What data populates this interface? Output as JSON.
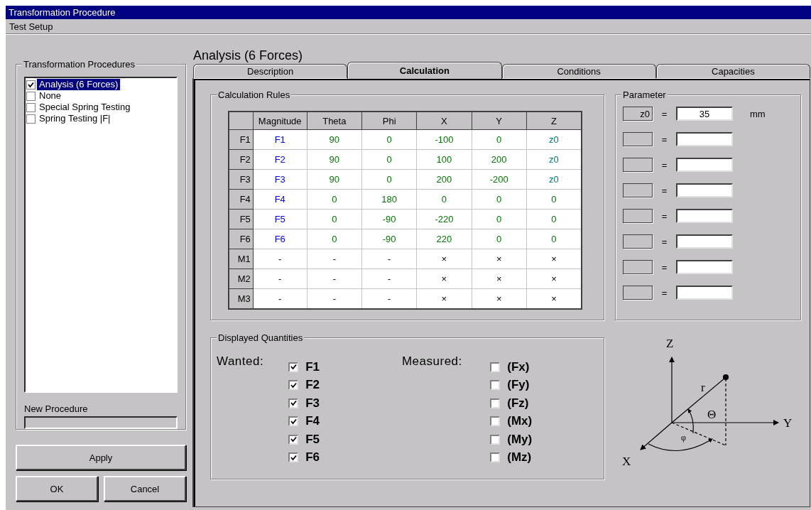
{
  "window": {
    "title": "Transformation Procedure"
  },
  "menu": [
    "Test Setup"
  ],
  "procedures": {
    "title": "Transformation Procedures",
    "items": [
      {
        "label": "Analysis (6 Forces)",
        "checked": true,
        "selected": true
      },
      {
        "label": "None",
        "checked": false,
        "selected": false
      },
      {
        "label": "Special Spring Testing",
        "checked": false,
        "selected": false
      },
      {
        "label": "Spring Testing |F|",
        "checked": false,
        "selected": false
      }
    ],
    "new_procedure": {
      "label": "New Procedure"
    }
  },
  "buttons": {
    "apply": "Apply",
    "ok": "OK",
    "cancel": "Cancel"
  },
  "heading": "Analysis (6 Forces)",
  "tabs": [
    {
      "label": "Description",
      "selected": false
    },
    {
      "label": "Calculation",
      "selected": true
    },
    {
      "label": "Conditions",
      "selected": false
    },
    {
      "label": "Capacities",
      "selected": false
    }
  ],
  "calculation_rules": {
    "title": "Calculation Rules",
    "columns": [
      "Magnitude",
      "Theta",
      "Phi",
      "X",
      "Y",
      "Z"
    ],
    "rows": [
      {
        "header": "F1",
        "cells": [
          {
            "text": "F1",
            "kind": "force"
          },
          {
            "text": "90",
            "kind": "value"
          },
          {
            "text": "0",
            "kind": "value"
          },
          {
            "text": "-100",
            "kind": "value"
          },
          {
            "text": "0",
            "kind": "value"
          },
          {
            "text": "z0",
            "kind": "param"
          }
        ]
      },
      {
        "header": "F2",
        "cells": [
          {
            "text": "F2",
            "kind": "force"
          },
          {
            "text": "90",
            "kind": "value"
          },
          {
            "text": "0",
            "kind": "value"
          },
          {
            "text": "100",
            "kind": "value"
          },
          {
            "text": "200",
            "kind": "value"
          },
          {
            "text": "z0",
            "kind": "param"
          }
        ]
      },
      {
        "header": "F3",
        "cells": [
          {
            "text": "F3",
            "kind": "force"
          },
          {
            "text": "90",
            "kind": "value"
          },
          {
            "text": "0",
            "kind": "value"
          },
          {
            "text": "200",
            "kind": "value"
          },
          {
            "text": "-200",
            "kind": "value"
          },
          {
            "text": "z0",
            "kind": "param"
          }
        ]
      },
      {
        "header": "F4",
        "cells": [
          {
            "text": "F4",
            "kind": "force"
          },
          {
            "text": "0",
            "kind": "value"
          },
          {
            "text": "180",
            "kind": "value"
          },
          {
            "text": "0",
            "kind": "value"
          },
          {
            "text": "0",
            "kind": "value"
          },
          {
            "text": "0",
            "kind": "value"
          }
        ]
      },
      {
        "header": "F5",
        "cells": [
          {
            "text": "F5",
            "kind": "force"
          },
          {
            "text": "0",
            "kind": "value"
          },
          {
            "text": "-90",
            "kind": "value"
          },
          {
            "text": "-220",
            "kind": "value"
          },
          {
            "text": "0",
            "kind": "value"
          },
          {
            "text": "0",
            "kind": "value"
          }
        ]
      },
      {
        "header": "F6",
        "cells": [
          {
            "text": "F6",
            "kind": "force"
          },
          {
            "text": "0",
            "kind": "value"
          },
          {
            "text": "-90",
            "kind": "value"
          },
          {
            "text": "220",
            "kind": "value"
          },
          {
            "text": "0",
            "kind": "value"
          },
          {
            "text": "0",
            "kind": "value"
          }
        ]
      },
      {
        "header": "M1",
        "cells": [
          {
            "text": "-",
            "kind": "plain"
          },
          {
            "text": "-",
            "kind": "plain"
          },
          {
            "text": "-",
            "kind": "plain"
          },
          {
            "text": "×",
            "kind": "plain"
          },
          {
            "text": "×",
            "kind": "plain"
          },
          {
            "text": "×",
            "kind": "plain"
          }
        ]
      },
      {
        "header": "M2",
        "cells": [
          {
            "text": "-",
            "kind": "plain"
          },
          {
            "text": "-",
            "kind": "plain"
          },
          {
            "text": "-",
            "kind": "plain"
          },
          {
            "text": "×",
            "kind": "plain"
          },
          {
            "text": "×",
            "kind": "plain"
          },
          {
            "text": "×",
            "kind": "plain"
          }
        ]
      },
      {
        "header": "M3",
        "cells": [
          {
            "text": "-",
            "kind": "plain"
          },
          {
            "text": "-",
            "kind": "plain"
          },
          {
            "text": "-",
            "kind": "plain"
          },
          {
            "text": "×",
            "kind": "plain"
          },
          {
            "text": "×",
            "kind": "plain"
          },
          {
            "text": "×",
            "kind": "plain"
          }
        ]
      }
    ]
  },
  "parameter": {
    "title": "Parameter",
    "rows": [
      {
        "name": "z0",
        "equals": "=",
        "value": "35",
        "unit": "mm"
      },
      {
        "equals": "="
      },
      {
        "equals": "="
      },
      {
        "equals": "="
      },
      {
        "equals": "="
      },
      {
        "equals": "="
      },
      {
        "equals": "="
      },
      {
        "equals": "="
      }
    ]
  },
  "displayed_quantities": {
    "title": "Displayed Quantities",
    "wanted_label": "Wanted:",
    "wanted": [
      {
        "label": "F1",
        "checked": true
      },
      {
        "label": "F2",
        "checked": true
      },
      {
        "label": "F3",
        "checked": true
      },
      {
        "label": "F4",
        "checked": true
      },
      {
        "label": "F5",
        "checked": true
      },
      {
        "label": "F6",
        "checked": true
      }
    ],
    "measured_label": "Measured:",
    "measured": [
      {
        "label": "(Fx)",
        "checked": false
      },
      {
        "label": "(Fy)",
        "checked": false
      },
      {
        "label": "(Fz)",
        "checked": false
      },
      {
        "label": "(Mx)",
        "checked": false
      },
      {
        "label": "(My)",
        "checked": false
      },
      {
        "label": "(Mz)",
        "checked": false
      }
    ]
  },
  "diagram": {
    "z_label": "Z",
    "y_label": "Y",
    "x_label": "X",
    "r_label": "r",
    "theta_label": "Θ",
    "phi_label": "φ"
  }
}
